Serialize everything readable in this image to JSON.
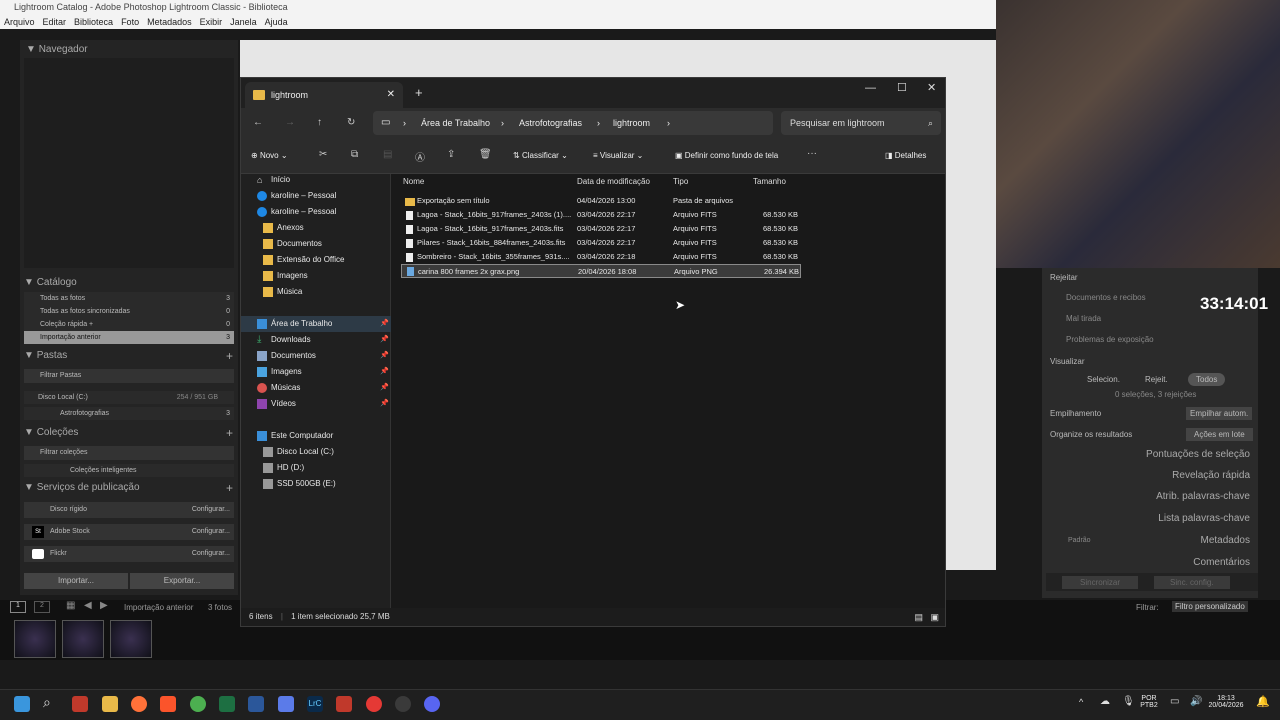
{
  "lr": {
    "title": "Lightroom Catalog - Adobe Photoshop Lightroom Classic - Biblioteca",
    "menu": [
      "Arquivo",
      "Editar",
      "Biblioteca",
      "Foto",
      "Metadados",
      "Exibir",
      "Janela",
      "Ajuda"
    ],
    "navigator": "Navegador",
    "catalog": {
      "title": "Catálogo",
      "items": [
        {
          "label": "Todas as fotos",
          "count": "3"
        },
        {
          "label": "Todas as fotos sincronizadas",
          "count": "0"
        },
        {
          "label": "Coleção rápida +",
          "count": "0"
        },
        {
          "label": "Importação anterior",
          "count": "3"
        }
      ]
    },
    "folders": {
      "title": "Pastas",
      "filter": "Filtrar Pastas",
      "disk": "Disco Local (C:)",
      "disk_size": "254 / 951 GB",
      "sub": "Astrofotografias",
      "sub_count": "3"
    },
    "collections": {
      "title": "Coleções",
      "filter": "Filtrar coleções",
      "smart": "Coleções inteligentes"
    },
    "publish": {
      "title": "Serviços de publicação",
      "items": [
        {
          "label": "Disco rígido",
          "action": "Configurar..."
        },
        {
          "label": "Adobe Stock",
          "action": "Configurar..."
        },
        {
          "label": "Flickr",
          "action": "Configurar..."
        }
      ]
    },
    "import_btn": "Importar...",
    "export_btn": "Exportar...",
    "filmstrip_label": "Importação anterior",
    "filmstrip_count": "3 fotos",
    "filter_label": "Filtrar:",
    "filter_value": "Filtro personalizado",
    "timer": "33:14:01",
    "right": {
      "reject": "Rejeitar",
      "checks": [
        "Documentos e recibos",
        "Mal tirada",
        "Problemas de exposição"
      ],
      "view": "Visualizar",
      "view_opts": [
        "Selecion.",
        "Rejeit.",
        "Todos"
      ],
      "summary": "0 seleções, 3 rejeições",
      "stacking": "Empilhamento",
      "stack_btn": "Empilhar autom.",
      "organize": "Organize os resultados",
      "organize_btn": "Ações em lote",
      "sections": [
        "Pontuações de seleção",
        "Revelação rápida",
        "Atrib. palavras-chave",
        "Lista palavras-chave",
        "Metadados",
        "Comentários"
      ],
      "preset": "Padrão",
      "sync": "Sincronizar",
      "sync_cfg": "Sinc. config."
    }
  },
  "explorer": {
    "tab_title": "lightroom",
    "breadcrumb": [
      "Área de Trabalho",
      "Astrofotografias",
      "lightroom"
    ],
    "search_placeholder": "Pesquisar em lightroom",
    "toolbar": {
      "new": "Novo",
      "sort": "Classificar",
      "view": "Visualizar",
      "wallpaper": "Definir como fundo de tela",
      "details": "Detalhes"
    },
    "nav": [
      {
        "label": "Início",
        "icon": "home-icon"
      },
      {
        "label": "karoline – Pessoal",
        "icon": "cloud-icon"
      },
      {
        "label": "karoline – Pessoal",
        "icon": "cloud-icon"
      },
      {
        "label": "Anexos",
        "icon": "folder-icon"
      },
      {
        "label": "Documentos",
        "icon": "folder-icon"
      },
      {
        "label": "Extensão do Office",
        "icon": "folder-icon"
      },
      {
        "label": "Imagens",
        "icon": "folder-icon"
      },
      {
        "label": "Música",
        "icon": "folder-icon"
      }
    ],
    "quick": [
      {
        "label": "Área de Trabalho",
        "icon": "desktop-icon"
      },
      {
        "label": "Downloads",
        "icon": "download-icon"
      },
      {
        "label": "Documentos",
        "icon": "document-icon"
      },
      {
        "label": "Imagens",
        "icon": "image-icon"
      },
      {
        "label": "Músicas",
        "icon": "music-icon"
      },
      {
        "label": "Vídeos",
        "icon": "video-icon"
      }
    ],
    "pc": [
      {
        "label": "Este Computador",
        "icon": "computer-icon"
      },
      {
        "label": "Disco Local (C:)",
        "icon": "drive-icon"
      },
      {
        "label": "HD (D:)",
        "icon": "drive-icon"
      },
      {
        "label": "SSD 500GB (E:)",
        "icon": "drive-icon"
      }
    ],
    "columns": [
      "Nome",
      "Data de modificação",
      "Tipo",
      "Tamanho"
    ],
    "files": [
      {
        "name": "Exportação sem título",
        "date": "04/04/2026 13:00",
        "type": "Pasta de arquivos",
        "size": ""
      },
      {
        "name": "Lagoa - Stack_16bits_917frames_2403s (1)....",
        "date": "03/04/2026 22:17",
        "type": "Arquivo FITS",
        "size": "68.530 KB"
      },
      {
        "name": "Lagoa - Stack_16bits_917frames_2403s.fits",
        "date": "03/04/2026 22:17",
        "type": "Arquivo FITS",
        "size": "68.530 KB"
      },
      {
        "name": "Pilares - Stack_16bits_884frames_2403s.fits",
        "date": "03/04/2026 22:17",
        "type": "Arquivo FITS",
        "size": "68.530 KB"
      },
      {
        "name": "Sombreiro - Stack_16bits_355frames_931s....",
        "date": "03/04/2026 22:18",
        "type": "Arquivo FITS",
        "size": "68.530 KB"
      },
      {
        "name": "carina 800 frames 2x grax.png",
        "date": "20/04/2026 18:08",
        "type": "Arquivo PNG",
        "size": "26.394 KB"
      }
    ],
    "status_items": "6 itens",
    "status_sel": "1 item selecionado  25,7 MB"
  },
  "taskbar": {
    "lang": "POR",
    "layout": "PTB2",
    "time": "18:13",
    "date": "20/04/2026"
  }
}
